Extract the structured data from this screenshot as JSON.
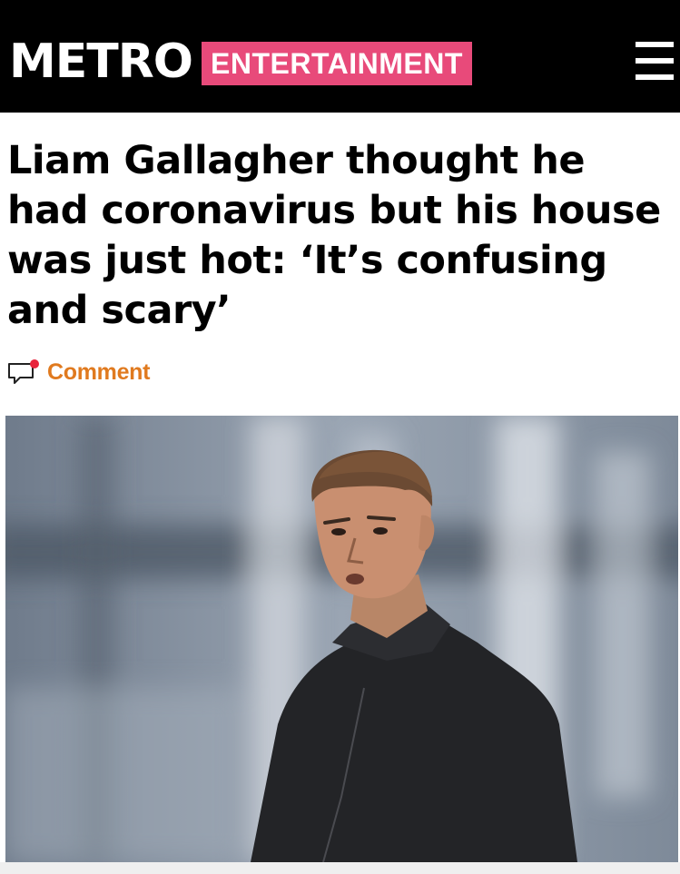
{
  "header": {
    "logo": "METRO",
    "section": "ENTERTAINMENT",
    "menu_icon": "hamburger-menu-icon",
    "section_color": "#e84a7a"
  },
  "article": {
    "headline": "Liam Gallagher thought he had coronavirus but his house was just hot: ‘It’s confusing and scary’",
    "comment_label": "Comment",
    "comment_icon": "speech-bubble-icon",
    "comment_color": "#e07a1f"
  }
}
